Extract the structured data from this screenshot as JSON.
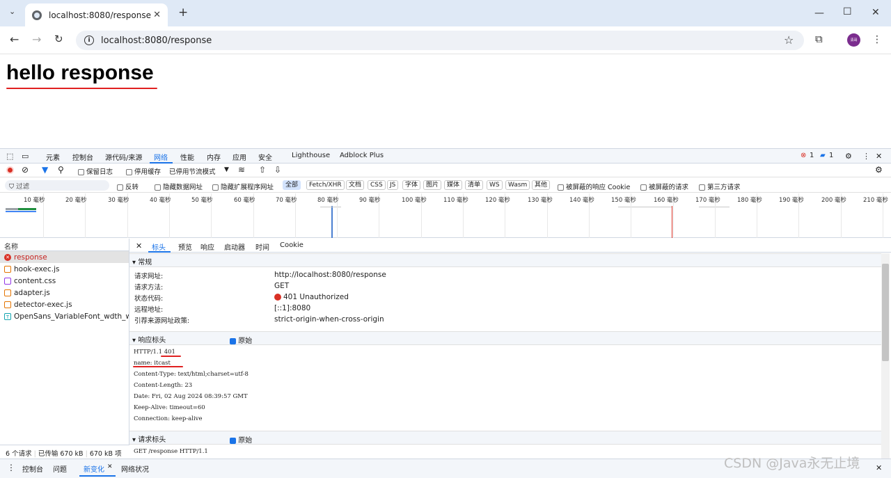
{
  "browser": {
    "tab_title": "localhost:8080/response",
    "new_tab": "+",
    "address": "localhost:8080/response",
    "avatar_text": "清哥"
  },
  "page": {
    "heading": "hello response"
  },
  "devtools": {
    "tabs": [
      "元素",
      "控制台",
      "源代码/来源",
      "网络",
      "性能",
      "内存",
      "应用",
      "安全",
      "Lighthouse",
      "Adblock Plus"
    ],
    "active_tab": "网络",
    "error_count": "1",
    "message_count": "1",
    "network_toolbar": {
      "preserve_log": "保留日志",
      "disable_cache": "停用缓存",
      "throttling": "已停用节流模式"
    },
    "filter_bar": {
      "filter_placeholder": "过滤",
      "invert": "反转",
      "hide_data_urls": "隐藏数据网址",
      "hide_extension_urls": "隐藏扩展程序网址",
      "type_pills": [
        "全部",
        "Fetch/XHR",
        "文档",
        "CSS",
        "JS",
        "字体",
        "图片",
        "媒体",
        "清单",
        "WS",
        "Wasm",
        "其他"
      ],
      "selected_pill": "全部",
      "blocked_cookies": "被屏蔽的响应 Cookie",
      "blocked_requests": "被屏蔽的请求",
      "third_party": "第三方请求"
    },
    "timeline_labels": [
      "10 毫秒",
      "20 毫秒",
      "30 毫秒",
      "40 毫秒",
      "50 毫秒",
      "60 毫秒",
      "70 毫秒",
      "80 毫秒",
      "90 毫秒",
      "100 毫秒",
      "110 毫秒",
      "120 毫秒",
      "130 毫秒",
      "140 毫秒",
      "150 毫秒",
      "160 毫秒",
      "170 毫秒",
      "180 毫秒",
      "190 毫秒",
      "200 毫秒",
      "210 毫秒"
    ],
    "names_header": "名称",
    "requests": [
      {
        "name": "response",
        "type": "error"
      },
      {
        "name": "hook-exec.js",
        "type": "js"
      },
      {
        "name": "content.css",
        "type": "css"
      },
      {
        "name": "adapter.js",
        "type": "js"
      },
      {
        "name": "detector-exec.js",
        "type": "js"
      },
      {
        "name": "OpenSans_VariableFont_wdth_wg...",
        "type": "font"
      }
    ],
    "detail_tabs": [
      "标头",
      "预览",
      "响应",
      "启动器",
      "时间",
      "Cookie"
    ],
    "active_detail_tab": "标头",
    "general": {
      "title": "常规",
      "rows": [
        {
          "key": "请求网址:",
          "value": "http://localhost:8080/response"
        },
        {
          "key": "请求方法:",
          "value": "GET"
        },
        {
          "key": "状态代码:",
          "value": "401 Unauthorized"
        },
        {
          "key": "远程地址:",
          "value": "[::1]:8080"
        },
        {
          "key": "引荐来源网址政策:",
          "value": "strict-origin-when-cross-origin"
        }
      ]
    },
    "response_headers": {
      "title": "响应标头",
      "raw_label": "原始",
      "lines": [
        "HTTP/1.1 401",
        "name: itcast",
        "Content-Type: text/html;charset=utf-8",
        "Content-Length: 23",
        "Date: Fri, 02 Aug 2024 08:39:57 GMT",
        "Keep-Alive: timeout=60",
        "Connection: keep-alive"
      ]
    },
    "request_headers": {
      "title": "请求标头",
      "raw_label": "原始",
      "lines": [
        "GET /response HTTP/1.1"
      ]
    },
    "status_bar": {
      "requests": "6 个请求",
      "transferred": "已传输 670 kB",
      "resources": "670 kB 项"
    },
    "drawer_tabs": [
      "控制台",
      "问题",
      "新变化",
      "网络状况"
    ],
    "active_drawer_tab": "新变化"
  },
  "watermark": "CSDN @Java永无止境",
  "colors": {
    "accent": "#1a73e8",
    "error": "#d93025",
    "annotation_red": "#e02020"
  }
}
